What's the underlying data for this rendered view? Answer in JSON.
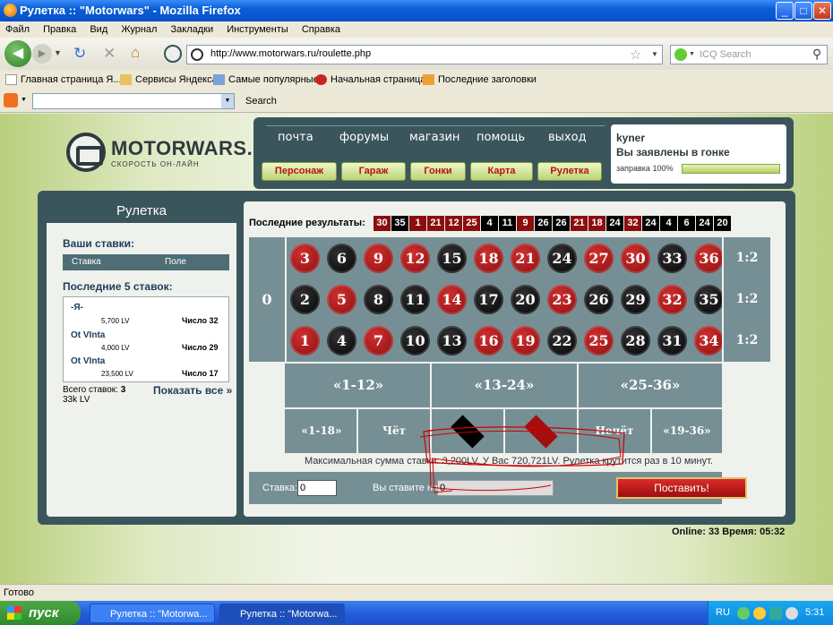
{
  "window": {
    "title": "Рулетка :: \"Motorwars\" - Mozilla Firefox",
    "min": "_",
    "max": "□",
    "close": "✕"
  },
  "menu": [
    "Файл",
    "Правка",
    "Вид",
    "Журнал",
    "Закладки",
    "Инструменты",
    "Справка"
  ],
  "toolbar": {
    "url": "http://www.motorwars.ru/roulette.php",
    "search_placeholder": "ICQ Search",
    "search_label": "Search"
  },
  "bookmarks": [
    "Главная страница Я...",
    "Сервисы Яндекса",
    "Самые популярные",
    "Начальная страница",
    "Последние заголовки"
  ],
  "site": {
    "logo_name": "MOTORWARS.RU",
    "logo_sub": "СКОРОСТЬ ОН-ЛАЙН",
    "top_links": [
      "почта",
      "форумы",
      "магазин",
      "помощь",
      "выход"
    ],
    "buttons": [
      "Персонаж",
      "Гараж",
      "Гонки",
      "Карта",
      "Рулетка"
    ],
    "user": {
      "name": "kyner",
      "status": "Вы заявлены в гонке",
      "fuel_label": "заправка 100%",
      "fuel_percent": 100
    }
  },
  "left": {
    "title": "Рулетка",
    "your_bets": "Ваши ставки:",
    "col_bet": "Ставка",
    "col_field": "Поле",
    "last5": "Последние 5 ставок:",
    "last_bets": [
      {
        "who": "-Я-",
        "amount": "5,700 LV",
        "field": "Число 32"
      },
      {
        "who": "Ot VInta",
        "amount": "4,000 LV",
        "field": "Число 29"
      },
      {
        "who": "Ot VInta",
        "amount": "23,500 LV",
        "field": "Число 17"
      }
    ],
    "total_label": "Всего ставок:",
    "total_count": "3",
    "total_sum": "33k LV",
    "show_all": "Показать все »"
  },
  "results": {
    "label": "Последние результаты:",
    "items": [
      {
        "n": "30",
        "c": "r"
      },
      {
        "n": "35",
        "c": "b"
      },
      {
        "n": "1",
        "c": "r"
      },
      {
        "n": "21",
        "c": "r"
      },
      {
        "n": "12",
        "c": "r"
      },
      {
        "n": "25",
        "c": "r"
      },
      {
        "n": "4",
        "c": "b"
      },
      {
        "n": "11",
        "c": "b"
      },
      {
        "n": "9",
        "c": "r"
      },
      {
        "n": "26",
        "c": "b"
      },
      {
        "n": "26",
        "c": "b"
      },
      {
        "n": "21",
        "c": "r"
      },
      {
        "n": "18",
        "c": "r"
      },
      {
        "n": "24",
        "c": "b"
      },
      {
        "n": "32",
        "c": "r"
      },
      {
        "n": "24",
        "c": "b"
      },
      {
        "n": "4",
        "c": "b"
      },
      {
        "n": "6",
        "c": "b"
      },
      {
        "n": "24",
        "c": "b"
      },
      {
        "n": "20",
        "c": "b"
      }
    ]
  },
  "table": {
    "zero": "0",
    "rows": [
      [
        {
          "n": "3",
          "c": "r"
        },
        {
          "n": "6",
          "c": "b"
        },
        {
          "n": "9",
          "c": "r"
        },
        {
          "n": "12",
          "c": "r"
        },
        {
          "n": "15",
          "c": "b"
        },
        {
          "n": "18",
          "c": "r"
        },
        {
          "n": "21",
          "c": "r"
        },
        {
          "n": "24",
          "c": "b"
        },
        {
          "n": "27",
          "c": "r"
        },
        {
          "n": "30",
          "c": "r"
        },
        {
          "n": "33",
          "c": "b"
        },
        {
          "n": "36",
          "c": "r"
        }
      ],
      [
        {
          "n": "2",
          "c": "b"
        },
        {
          "n": "5",
          "c": "r"
        },
        {
          "n": "8",
          "c": "b"
        },
        {
          "n": "11",
          "c": "b"
        },
        {
          "n": "14",
          "c": "r"
        },
        {
          "n": "17",
          "c": "b"
        },
        {
          "n": "20",
          "c": "b"
        },
        {
          "n": "23",
          "c": "r"
        },
        {
          "n": "26",
          "c": "b"
        },
        {
          "n": "29",
          "c": "b"
        },
        {
          "n": "32",
          "c": "r"
        },
        {
          "n": "35",
          "c": "b"
        }
      ],
      [
        {
          "n": "1",
          "c": "r"
        },
        {
          "n": "4",
          "c": "b"
        },
        {
          "n": "7",
          "c": "r"
        },
        {
          "n": "10",
          "c": "b"
        },
        {
          "n": "13",
          "c": "b"
        },
        {
          "n": "16",
          "c": "r"
        },
        {
          "n": "19",
          "c": "r"
        },
        {
          "n": "22",
          "c": "b"
        },
        {
          "n": "25",
          "c": "r"
        },
        {
          "n": "28",
          "c": "b"
        },
        {
          "n": "31",
          "c": "b"
        },
        {
          "n": "34",
          "c": "r"
        }
      ]
    ],
    "columns": [
      "1:2",
      "1:2",
      "1:2"
    ],
    "dozens": [
      "«1-12»",
      "«13-24»",
      "«25-36»"
    ],
    "outside": [
      "«1-18»",
      "Чёт",
      "Нечёт",
      "«19-36»"
    ]
  },
  "info": "Максимальная сумма ставки: 3,200LV. У Вас 720,721LV. Рулетка крутится раз в 10 минут.",
  "betform": {
    "stake_label": "Ставка:",
    "stake_value": "0",
    "on_label": "Вы ставите на:",
    "on_value": "0",
    "submit": "Поставить!"
  },
  "online": "Online: 33  Время: 05:32",
  "status": "Готово",
  "taskbar": {
    "start": "пуск",
    "tasks": [
      "Рулетка :: \"Motorwa...",
      "Рулетка :: \"Motorwa..."
    ],
    "lang": "RU",
    "clock": "5:31"
  },
  "colors": {
    "red": "#8a0e0e",
    "black": "#000000",
    "panel": "#3b555c",
    "felt": "#768f95"
  }
}
